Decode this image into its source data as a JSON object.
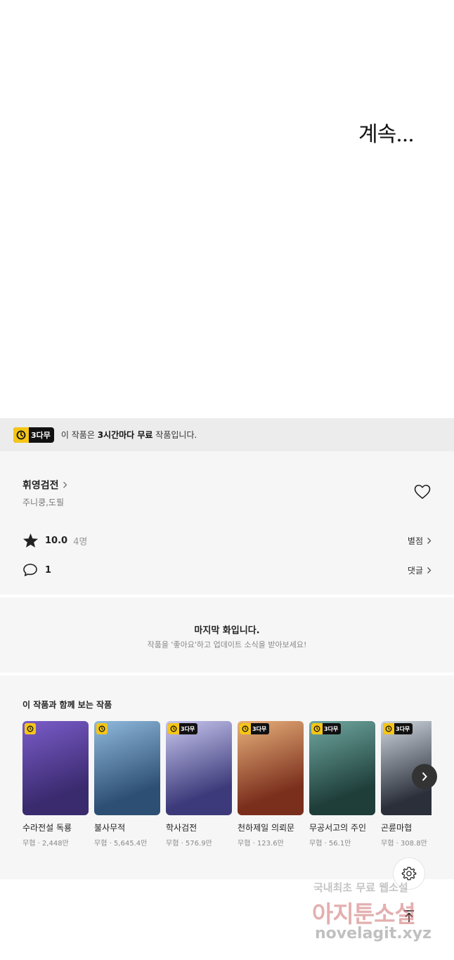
{
  "comic": {
    "text": "계속..."
  },
  "free_banner": {
    "badge": "3다무",
    "text_prefix": "이 작품은 ",
    "text_bold": "3시간마다 무료",
    "text_suffix": " 작품입니다."
  },
  "series": {
    "title": "휘영검전",
    "authors": "주니쿵,도필",
    "rating": "10.0",
    "rating_count": "4명",
    "rating_link": "별점",
    "comment_count": "1",
    "comment_link": "댓글"
  },
  "last_episode": {
    "title": "마지막 화입니다.",
    "subtitle": "작품을 '좋아요'하고 업데이트 소식을 받아보세요!"
  },
  "recommendations": {
    "title": "이 작품과 함께 보는 작품",
    "items": [
      {
        "name": "수라전설 독룡",
        "meta": "무협 · 2,448만",
        "badge": "",
        "color1": "#3a2a6e",
        "color2": "#7a5cc9"
      },
      {
        "name": "불사무적",
        "meta": "무협 · 5,645.4만",
        "badge": "",
        "color1": "#2d4f73",
        "color2": "#8fb9dc"
      },
      {
        "name": "학사검전",
        "meta": "무협 · 576.9만",
        "badge": "3다무",
        "color1": "#3c3a7a",
        "color2": "#c7c6ee"
      },
      {
        "name": "천하제일 의뢰문",
        "meta": "무협 · 123.6만",
        "badge": "3다무",
        "color1": "#7a2e1c",
        "color2": "#e8b07a"
      },
      {
        "name": "무공서고의 주인",
        "meta": "무협 · 56.1만",
        "badge": "3다무",
        "color1": "#1f3e3a",
        "color2": "#6fa8a0"
      },
      {
        "name": "곤륜마협",
        "meta": "무협 · 308.8만",
        "badge": "3다무",
        "color1": "#2a2f3a",
        "color2": "#cfd6de"
      }
    ]
  },
  "watermark": {
    "line1": "국내최초 무료 웹소설",
    "line2": "아지툰소설",
    "line3": "novelagit.xyz"
  }
}
